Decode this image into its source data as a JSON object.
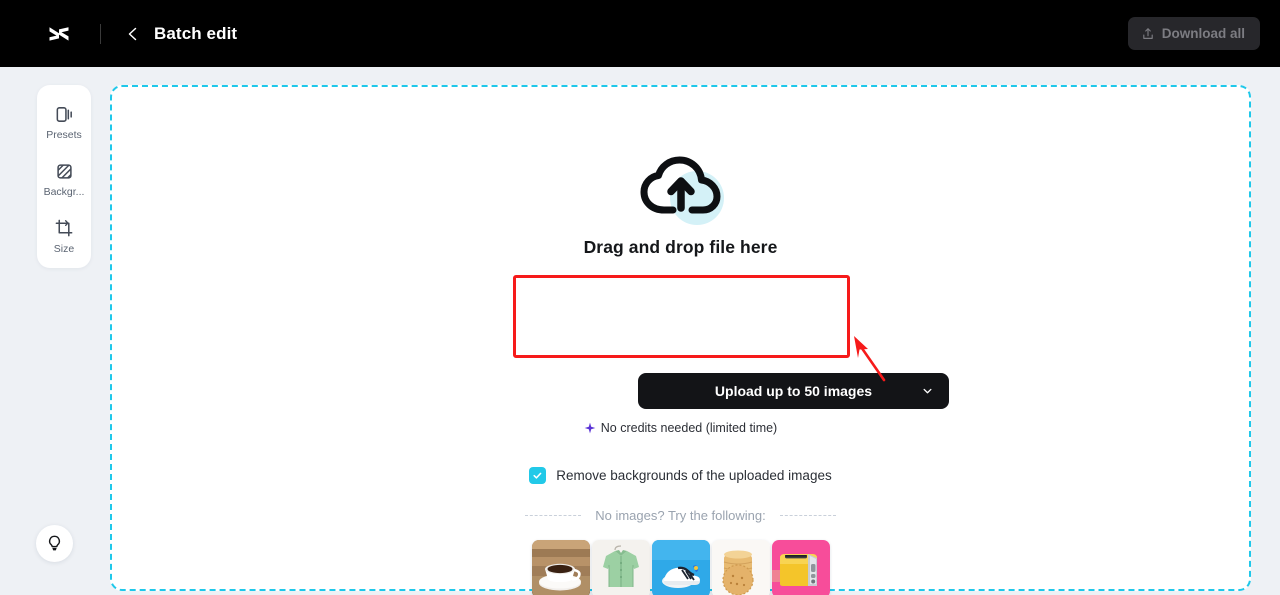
{
  "topbar": {
    "logo_icon": "capcut-logo-icon",
    "back_icon": "chevron-left-icon",
    "title": "Batch edit",
    "download_all": {
      "label": "Download all",
      "icon": "download-share-icon",
      "enabled": false,
      "bg_color": "#27272b",
      "text_color": "#7c7c82"
    },
    "bg_color": "#000000"
  },
  "sidebar": {
    "items": [
      {
        "label": "Presets",
        "icon": "presets-icon"
      },
      {
        "label": "Backgr...",
        "icon": "background-icon"
      },
      {
        "label": "Size",
        "icon": "crop-size-icon"
      }
    ]
  },
  "help_button": {
    "icon": "lightbulb-icon"
  },
  "dropzone": {
    "border_color": "#1fc8ea",
    "cloud_icon": "cloud-upload-icon",
    "title": "Drag and drop file here",
    "upload_button": {
      "label": "Upload up to 50 images",
      "chevron_icon": "chevron-down-icon",
      "bg_color": "#131417"
    },
    "credits_note": {
      "icon": "sparkle-icon",
      "icon_color": "#5b34d6",
      "text": "No credits needed (limited time)"
    },
    "checkbox": {
      "label": "Remove backgrounds of the uploaded images",
      "checked": true,
      "color": "#22c9e8"
    },
    "try_row": {
      "text": "No images? Try the following:"
    },
    "samples": [
      {
        "name": "coffee-cup-sample",
        "bg_color": "#b08b62"
      },
      {
        "name": "green-shirt-sample",
        "bg_color": "#f2f0ec"
      },
      {
        "name": "sneakers-sample",
        "bg_color": "#2aa7e8"
      },
      {
        "name": "cookies-sample",
        "bg_color": "#f7f5f2"
      },
      {
        "name": "yellow-toaster-sample",
        "bg_color": "#f74d9a"
      }
    ]
  },
  "annotation": {
    "highlight_color": "#f61a1a",
    "arrow_icon": "red-arrow-icon"
  }
}
